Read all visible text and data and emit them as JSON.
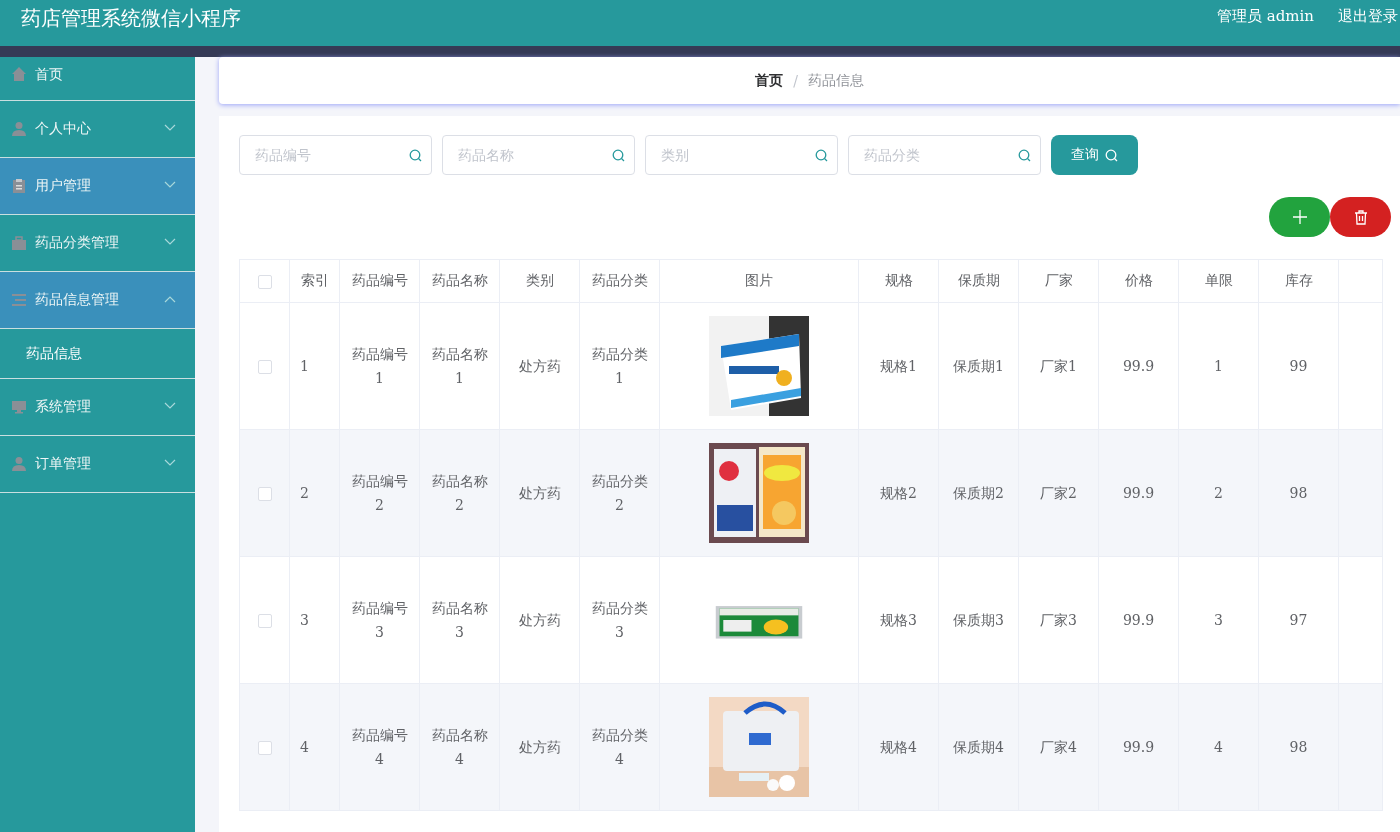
{
  "header": {
    "title": "药店管理系统微信小程序",
    "user": "管理员 admin",
    "logout": "退出登录"
  },
  "sidebar": {
    "items": [
      {
        "kind": "link",
        "label": "首页",
        "highlighted": false
      },
      {
        "kind": "group",
        "label": "个人中心",
        "highlighted": false,
        "expanded": false
      },
      {
        "kind": "group",
        "label": "用户管理",
        "highlighted": true,
        "expanded": false
      },
      {
        "kind": "group",
        "label": "药品分类管理",
        "highlighted": false,
        "expanded": false
      },
      {
        "kind": "group",
        "label": "药品信息管理",
        "highlighted": true,
        "expanded": true,
        "children": [
          {
            "label": "药品信息"
          }
        ]
      },
      {
        "kind": "group",
        "label": "系统管理",
        "highlighted": false,
        "expanded": false
      },
      {
        "kind": "group",
        "label": "订单管理",
        "highlighted": false,
        "expanded": false
      }
    ]
  },
  "breadcrumb": [
    "首页",
    "/",
    "药品信息"
  ],
  "search": {
    "fields": [
      {
        "placeholder": "药品编号"
      },
      {
        "placeholder": "药品名称"
      },
      {
        "placeholder": "类别"
      },
      {
        "placeholder": "药品分类"
      }
    ],
    "button": "查询"
  },
  "table": {
    "all_checked": false,
    "columns": [
      "索引",
      "药品编号",
      "药品名称",
      "类别",
      "药品分类",
      "图片",
      "规格",
      "保质期",
      "厂家",
      "价格",
      "单限",
      "库存"
    ],
    "rows": [
      {
        "checked": false,
        "cells": [
          "1",
          "药品编号1",
          "药品名称1",
          "处方药",
          "药品分类1",
          null,
          "规格1",
          "保质期1",
          "厂家1",
          "99.9",
          "1",
          "99"
        ]
      },
      {
        "checked": false,
        "cells": [
          "2",
          "药品编号2",
          "药品名称2",
          "处方药",
          "药品分类2",
          null,
          "规格2",
          "保质期2",
          "厂家2",
          "99.9",
          "2",
          "98"
        ]
      },
      {
        "checked": false,
        "cells": [
          "3",
          "药品编号3",
          "药品名称3",
          "处方药",
          "药品分类3",
          null,
          "规格3",
          "保质期3",
          "厂家3",
          "99.9",
          "3",
          "97"
        ]
      },
      {
        "checked": false,
        "cells": [
          "4",
          "药品编号4",
          "药品名称4",
          "处方药",
          "药品分类4",
          null,
          "规格4",
          "保质期4",
          "厂家4",
          "99.9",
          "4",
          "98"
        ]
      }
    ]
  }
}
